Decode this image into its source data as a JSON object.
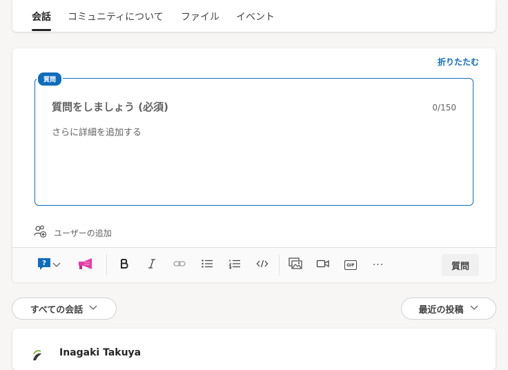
{
  "tabs": [
    {
      "label": "会話"
    },
    {
      "label": "コミュニティについて"
    },
    {
      "label": "ファイル"
    },
    {
      "label": "イベント"
    }
  ],
  "composer": {
    "collapse_label": "折りたたむ",
    "badge": "質問",
    "title_placeholder": "質問をしましょう (必須)",
    "char_count": "0/150",
    "detail_placeholder": "さらに詳細を追加する",
    "add_user_label": "ユーザーの追加",
    "submit_label": "質問"
  },
  "toolbar": {
    "gif_label": "GIF",
    "more_label": "···"
  },
  "filters": {
    "all_conversations": "すべての会話",
    "sort": "最近の投稿"
  },
  "post": {
    "author": "Inagaki Takuya"
  },
  "colors": {
    "accent": "#0f6cbd",
    "praise": "#e43ba6"
  }
}
